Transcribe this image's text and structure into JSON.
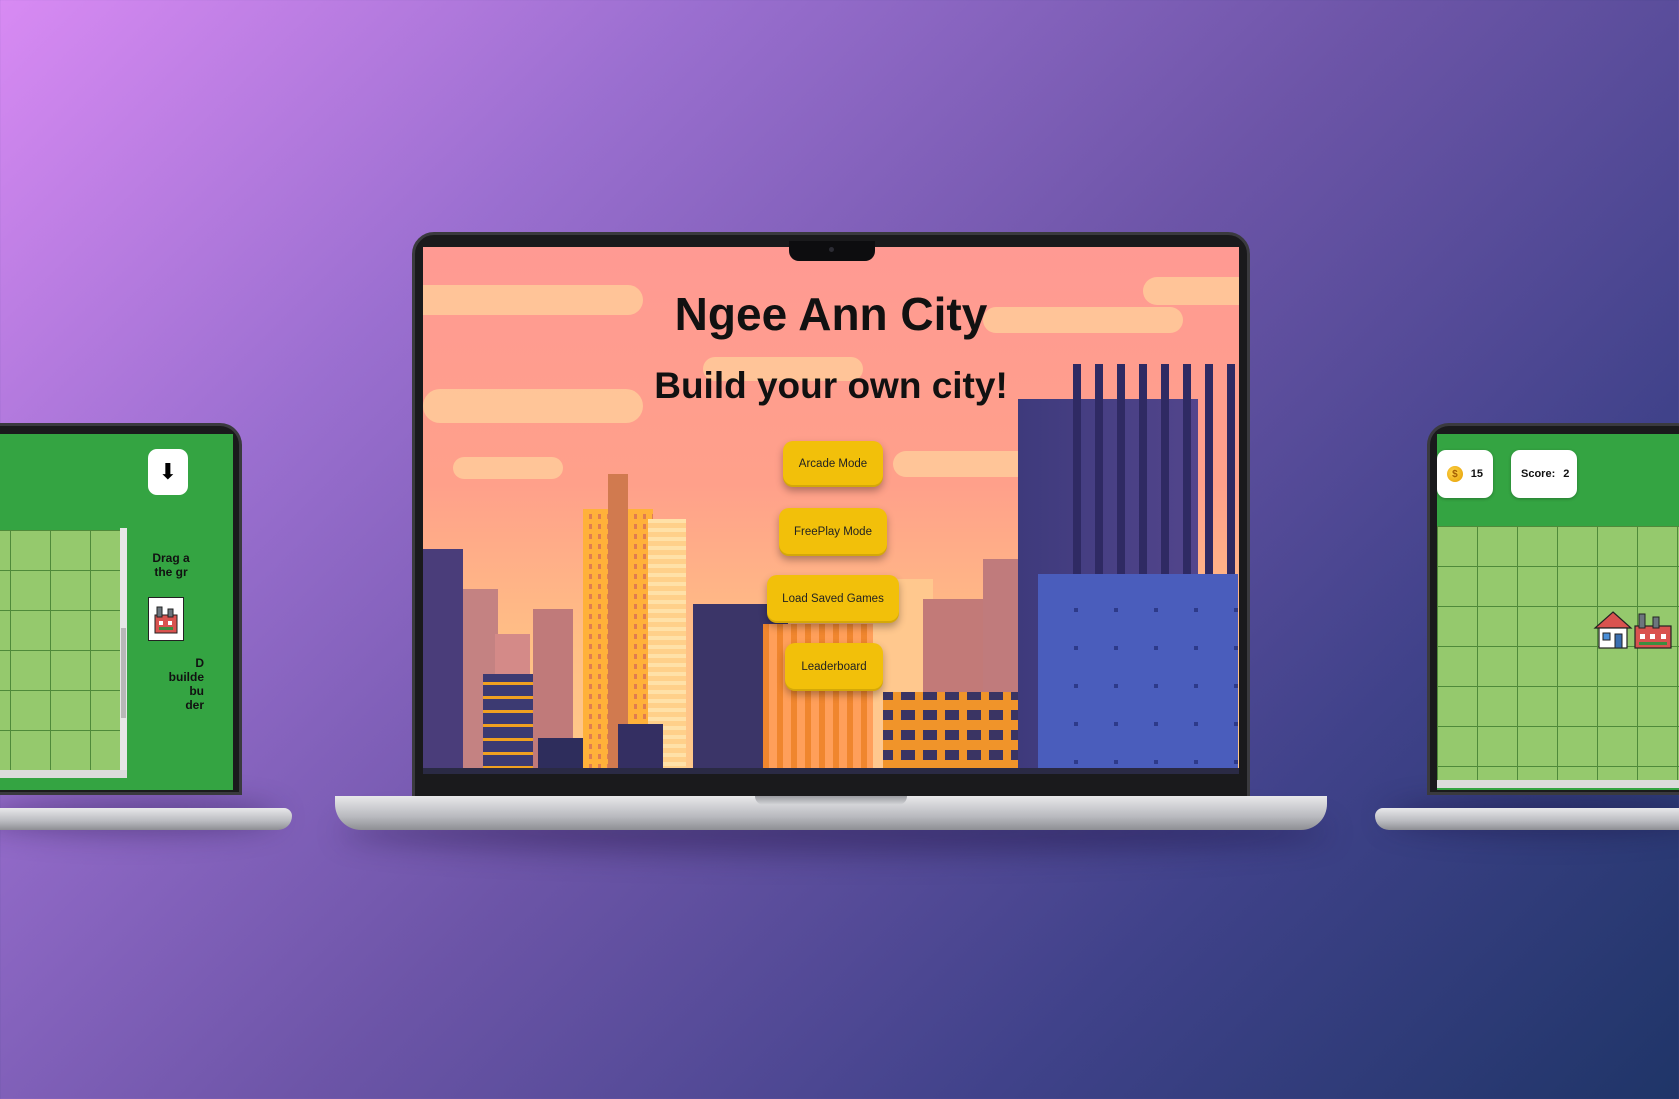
{
  "center_screen": {
    "title": "Ngee Ann City",
    "subtitle": "Build your own city!",
    "menu": [
      {
        "label": "Arcade Mode"
      },
      {
        "label": "FreePlay Mode"
      },
      {
        "label": "Load Saved Games"
      },
      {
        "label": "Leaderboard"
      }
    ]
  },
  "left_screen": {
    "instructions_top": [
      "Drag a",
      "the gr"
    ],
    "instructions_bottom": [
      "D",
      "builde",
      "bu",
      "der"
    ],
    "download_icon": "download-icon",
    "building_icon": "factory-icon"
  },
  "right_screen": {
    "coins": "15",
    "score_label": "Score:",
    "score_value": "2",
    "coin_icon": "coin-icon",
    "placed_icons": [
      "house-icon",
      "factory-icon"
    ]
  },
  "colors": {
    "button_yellow": "#f2c00a",
    "game_green": "#34a442",
    "grid_green": "#95c96d"
  }
}
